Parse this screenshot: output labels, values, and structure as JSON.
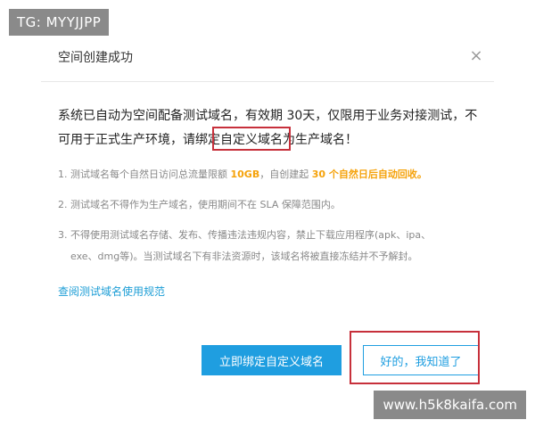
{
  "watermarks": {
    "top": "TG: MYYJJPP",
    "bottom": "www.h5k8kaifa.com"
  },
  "dialog": {
    "title": "空间创建成功",
    "close_icon": "×",
    "main_message": {
      "part1": "系统已自动为空间配备测试域名，有效期 30天，仅限用于业务对接测试，不可用于正式生产环境，请绑定",
      "highlight": "自定义域名",
      "part2": "为生产域名！"
    },
    "notes": [
      {
        "prefix": "1. 测试域名每个自然日访问总流量限额 ",
        "emph1": "10GB",
        "mid": "，自创建起 ",
        "emph2": "30 个自然日后自动回收。"
      },
      {
        "text": "2. 测试域名不得作为生产域名，使用期间不在 SLA 保障范围内。"
      },
      {
        "line1": "3. 不得使用测试域名存储、发布、传播违法违规内容，禁止下载应用程序(apk、ipa、",
        "line2": "exe、dmg等)。当测试域名下有非法资源时，该域名将被直接冻结并不予解封。"
      }
    ],
    "link": "查阅测试域名使用规范",
    "buttons": {
      "bind": "立即绑定自定义域名",
      "ok": "好的，我知道了"
    }
  },
  "colors": {
    "accent": "#1f9ee0",
    "highlight_orange": "#f5a20a",
    "annotation_red": "#c7303b"
  }
}
